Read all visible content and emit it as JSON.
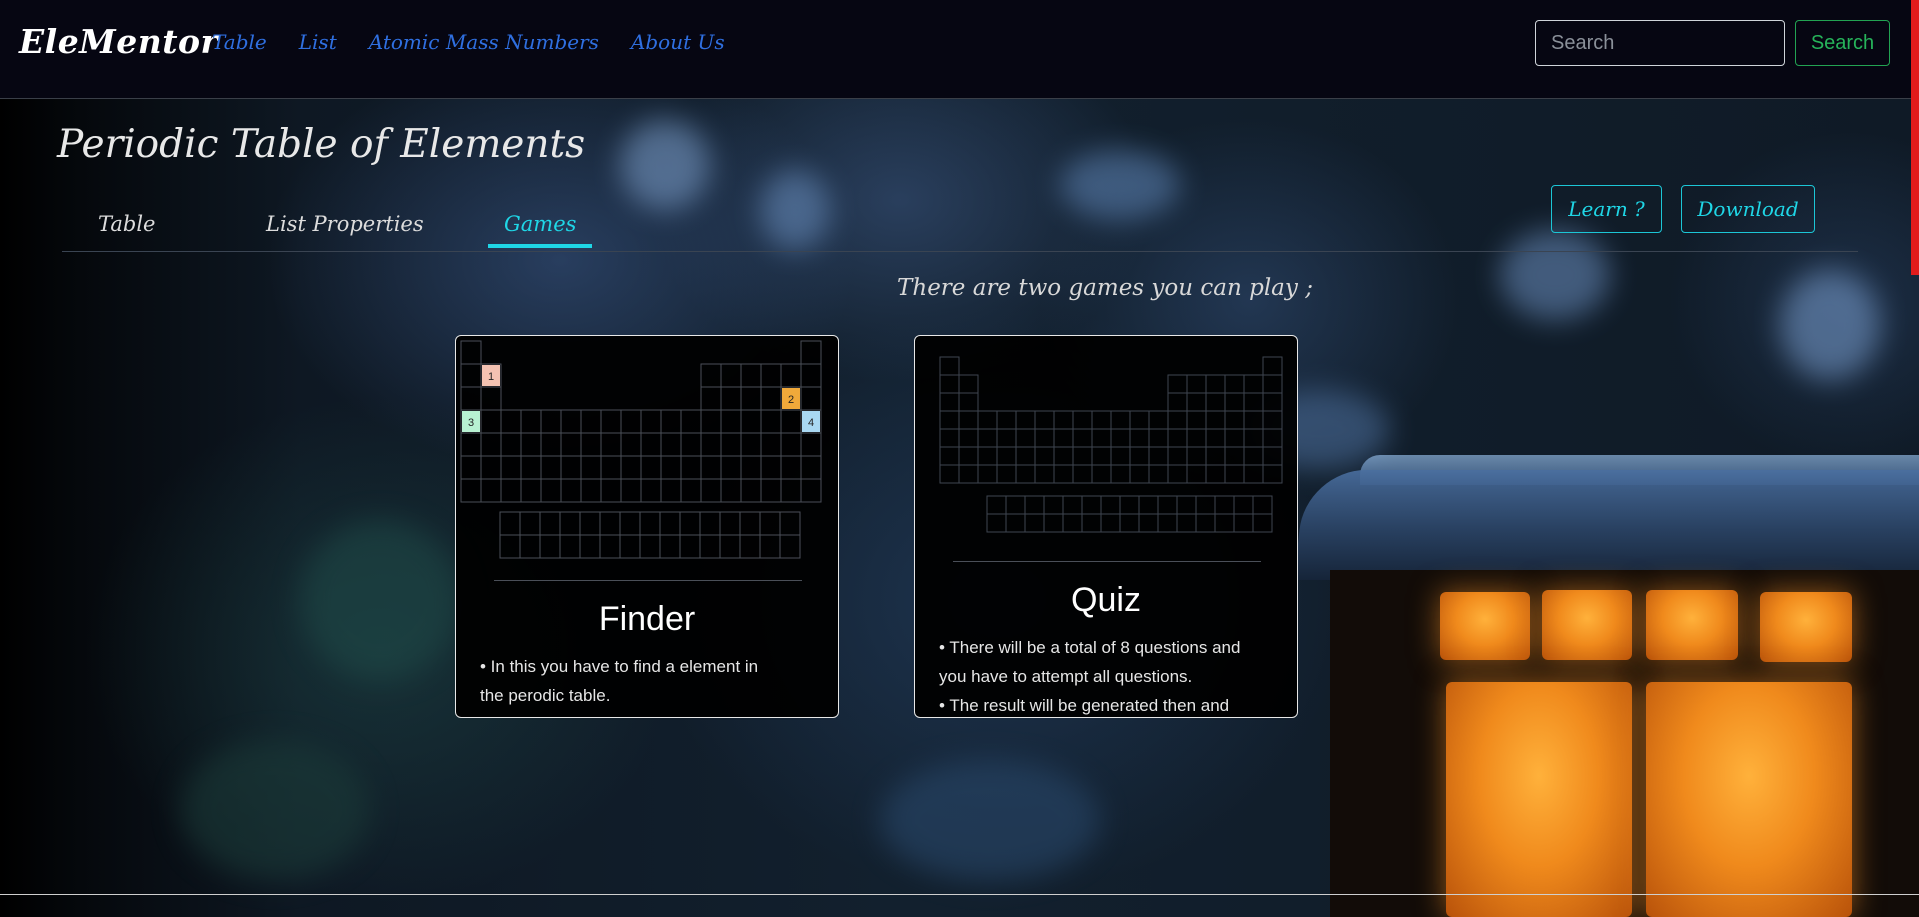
{
  "navbar": {
    "brand": "EleMentor",
    "links": [
      "Table",
      "List",
      "Atomic Mass Numbers",
      "About Us"
    ],
    "search_placeholder": "Search",
    "search_button": "Search"
  },
  "header": {
    "title": "Periodic Table of Elements",
    "tabs": [
      "Table",
      "List Properties",
      "Games"
    ],
    "active_tab": "Games",
    "learn_button": "Learn ?",
    "download_button": "Download"
  },
  "intro": "There are two games you can play ;",
  "cards": [
    {
      "title": "Finder",
      "markers": [
        "1",
        "2",
        "3",
        "4"
      ],
      "lines": [
        "• In this you have to find a element in",
        "the perodic table."
      ]
    },
    {
      "title": "Quiz",
      "lines": [
        "• There will be a total of 8 questions and",
        "you have to attempt all questions.",
        "• The result will be generated then and"
      ]
    }
  ],
  "colors": {
    "accent": "#1fd6e6",
    "nav_link": "#2f6fe0",
    "search_button": "#26b35a",
    "scrollbar": "#e21b1b",
    "marker_1": "#f4c2b2",
    "marker_2": "#f0a93a",
    "marker_3": "#b8f2d2",
    "marker_4": "#a9d8f2"
  }
}
